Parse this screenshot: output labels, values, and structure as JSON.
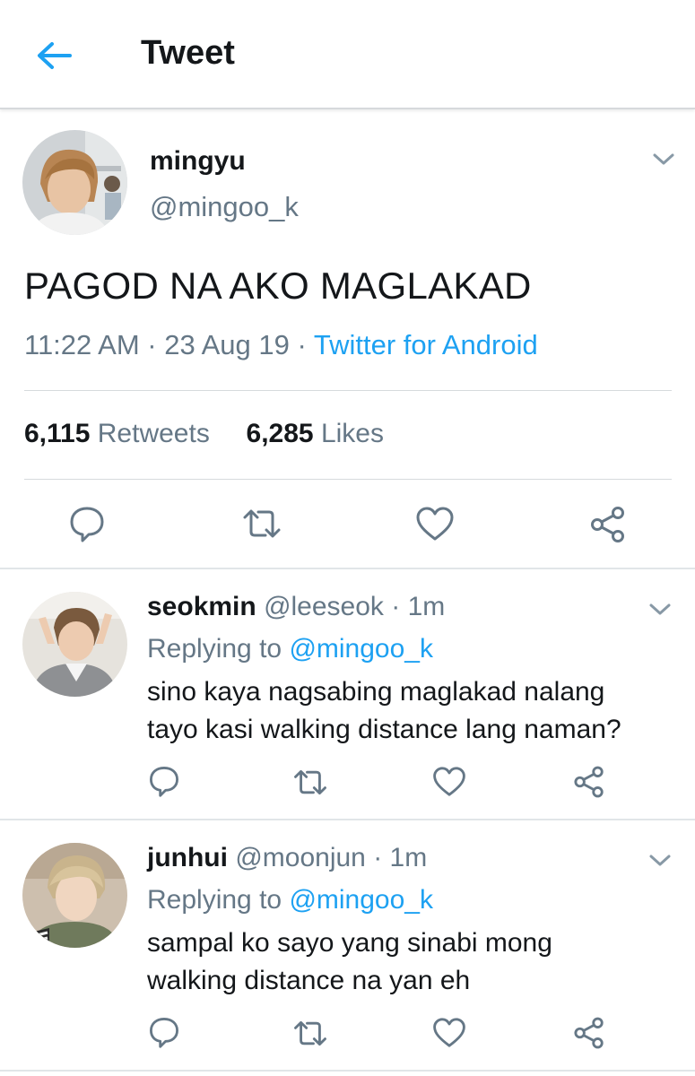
{
  "header": {
    "title": "Tweet"
  },
  "main_tweet": {
    "name": "mingyu",
    "handle": "@mingoo_k",
    "text": "PAGOD NA AKO MAGLAKAD",
    "time": "11:22 AM",
    "sep1": " · ",
    "date": "23 Aug 19",
    "sep2": " · ",
    "source": "Twitter for Android",
    "retweets_count": "6,115",
    "retweets_label": "Retweets",
    "likes_count": "6,285",
    "likes_label": "Likes"
  },
  "replies": [
    {
      "name": "seokmin",
      "handle_time": "@leeseok · 1m",
      "replying_prefix": "Replying to ",
      "replying_mention": "@mingoo_k",
      "text_line1": "sino kaya nagsabing maglakad nalang",
      "text_line2": "tayo kasi walking distance lang naman?"
    },
    {
      "name": "junhui",
      "handle_time": "@moonjun · 1m",
      "replying_prefix": "Replying to ",
      "replying_mention": "@mingoo_k",
      "text_line1": "sampal ko sayo yang sinabi mong",
      "text_line2": "walking distance na yan eh"
    }
  ],
  "colors": {
    "accent": "#1da1f2",
    "text": "#14171a",
    "secondary": "#657786",
    "icon": "#657786"
  },
  "icons": [
    "back-arrow-icon",
    "chevron-down-icon",
    "reply-icon",
    "retweet-icon",
    "like-icon",
    "share-icon"
  ]
}
